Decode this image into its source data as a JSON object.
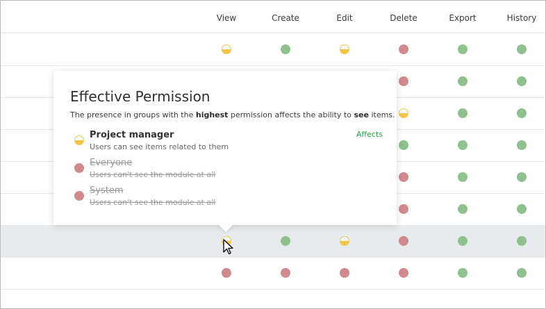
{
  "columns": [
    "View",
    "Create",
    "Edit",
    "Delete",
    "Export",
    "History"
  ],
  "rows": [
    [
      "partial",
      "allow",
      "partial",
      "deny",
      "allow",
      "allow"
    ],
    [
      "",
      "",
      "",
      "deny",
      "allow",
      "allow"
    ],
    [
      "",
      "",
      "",
      "partial",
      "allow",
      "allow"
    ],
    [
      "",
      "",
      "",
      "allow",
      "allow",
      "allow"
    ],
    [
      "",
      "",
      "",
      "deny",
      "allow",
      "allow"
    ],
    [
      "",
      "",
      "",
      "deny",
      "allow",
      "allow"
    ],
    [
      "partial",
      "allow",
      "partial",
      "deny",
      "allow",
      "allow"
    ],
    [
      "deny",
      "deny",
      "deny",
      "deny",
      "allow",
      "allow"
    ]
  ],
  "highlighted_row": 6,
  "colors": {
    "allow": "#8fc08e",
    "deny": "#cf8a8e",
    "partial": "#f3c64a",
    "affects": "#27a047"
  },
  "popover": {
    "title": "Effective Permission",
    "description_parts": [
      "The presence in groups with the ",
      "highest",
      " permission affects the ability to ",
      "see",
      " items."
    ],
    "items": [
      {
        "name": "Project manager",
        "sub": "Users can see items related to them",
        "level": "partial",
        "struck": false,
        "badge": "Affects"
      },
      {
        "name": "Everyone",
        "sub": "Users can't see the module at all",
        "level": "deny",
        "struck": true,
        "badge": ""
      },
      {
        "name": "System",
        "sub": "Users can't see the module at all",
        "level": "deny",
        "struck": true,
        "badge": ""
      }
    ]
  },
  "icons": {
    "cursor": "arrow-cursor-icon"
  }
}
